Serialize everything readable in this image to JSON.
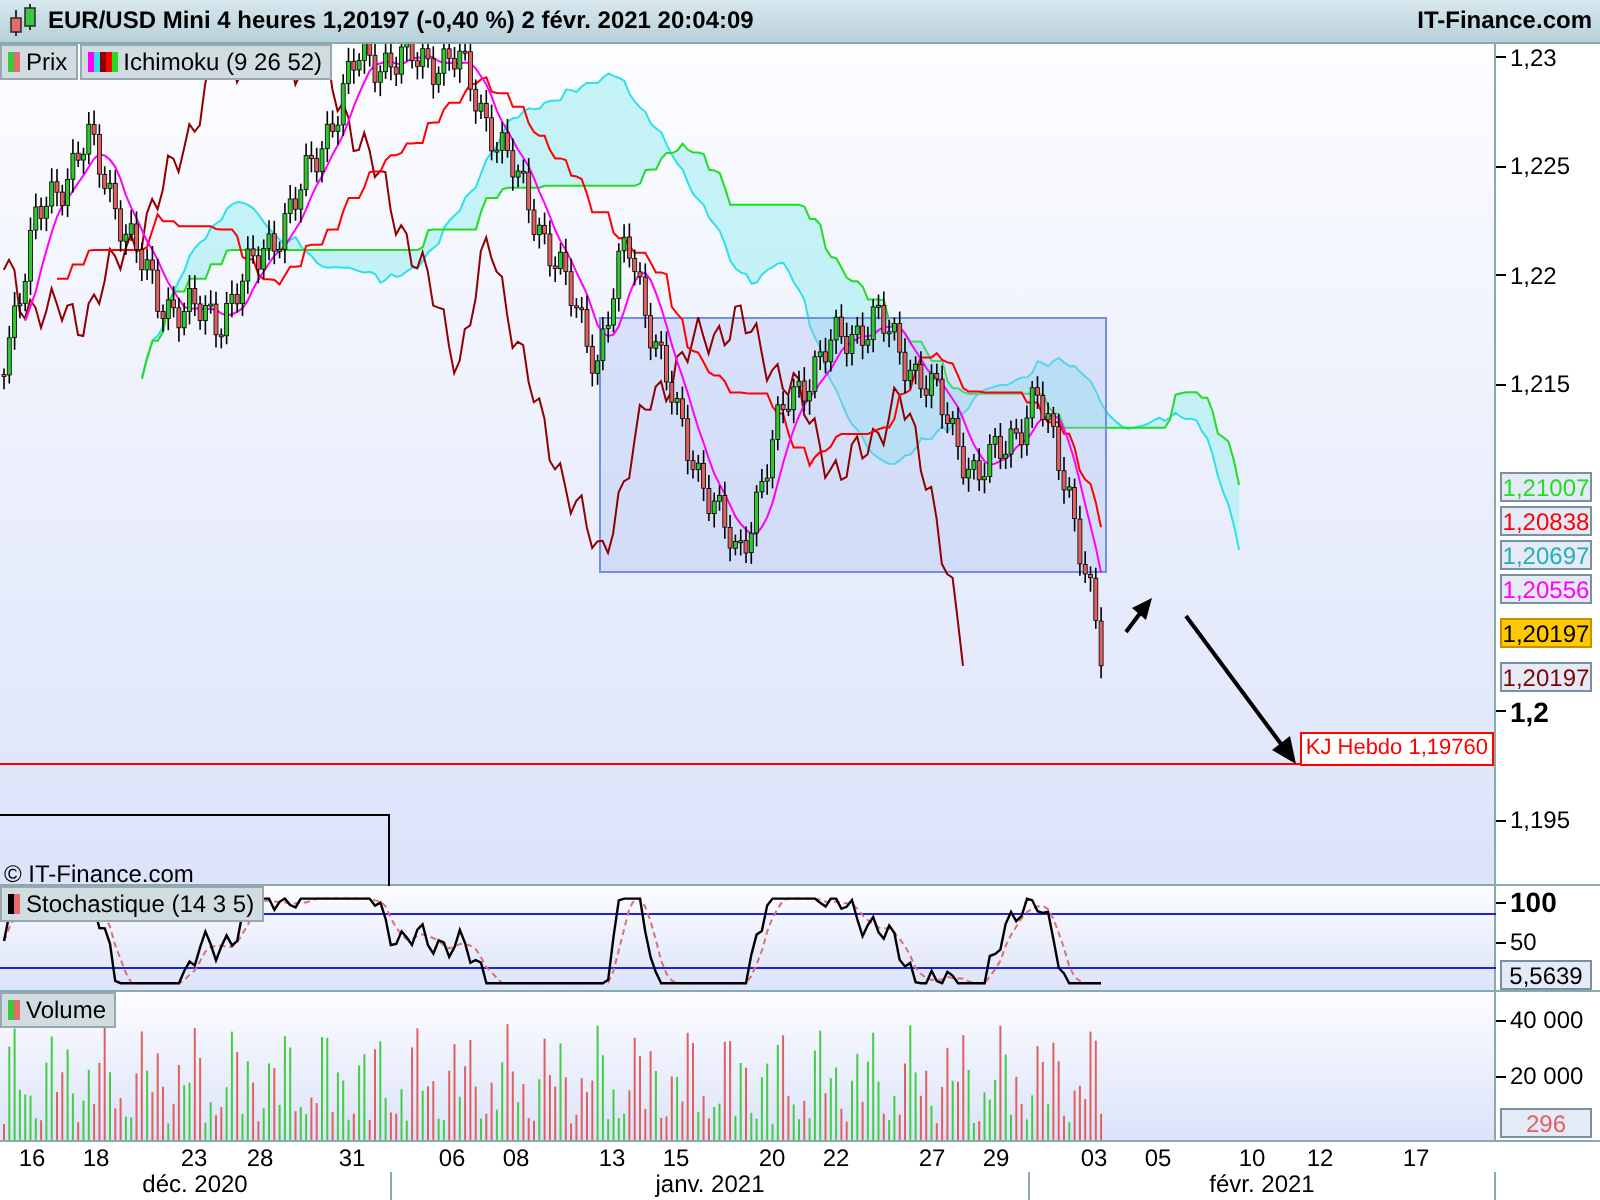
{
  "header": {
    "title": "EUR/USD Mini 4 heures 1,20197 (-0,40 %) 2 févr. 2021 20:04:09",
    "site": "IT-Finance.com"
  },
  "legends": [
    {
      "label": "Prix",
      "kind": "candles"
    },
    {
      "label": "Ichimoku (9 26 52)",
      "kind": "ichimoku"
    }
  ],
  "price_axis": {
    "ticks": [
      {
        "label": "1,23",
        "bold": false
      },
      {
        "label": "1,225",
        "bold": false
      },
      {
        "label": "1,22",
        "bold": false
      },
      {
        "label": "1,215",
        "bold": false
      },
      {
        "label": "1,2",
        "bold": true
      },
      {
        "label": "1,195",
        "bold": false
      }
    ]
  },
  "price_labels": [
    {
      "text": "1,21007",
      "color": "#22dd22",
      "highlighted": false
    },
    {
      "text": "1,20838",
      "color": "#ff0000",
      "highlighted": false
    },
    {
      "text": "1,20697",
      "color": "#20b0b8",
      "highlighted": false
    },
    {
      "text": "1,20556",
      "color": "#ff00ff",
      "highlighted": false
    },
    {
      "text": "1,20197",
      "highlighted": true
    },
    {
      "text": "1,20197",
      "color": "#800000",
      "highlighted": false
    }
  ],
  "annotation": {
    "text": "KJ Hebdo 1,19760"
  },
  "copyright": "© IT-Finance.com",
  "stochastic": {
    "legend": "Stochastique (14 3 5)",
    "ticks": [
      {
        "label": "100",
        "bold": true
      },
      {
        "label": "50",
        "bold": false
      }
    ],
    "reading": "5,5639"
  },
  "volume": {
    "legend": "Volume",
    "ticks": [
      {
        "label": "40 000",
        "bold": false
      },
      {
        "label": "20 000",
        "bold": false
      }
    ],
    "reading": "296"
  },
  "time_axis": {
    "days": [
      "16",
      "18",
      "23",
      "28",
      "31",
      "06",
      "08",
      "13",
      "15",
      "20",
      "22",
      "27",
      "29",
      "03",
      "05",
      "10",
      "12",
      "17"
    ],
    "months": [
      "déc. 2020",
      "janv. 2021",
      "févr. 2021"
    ]
  }
}
